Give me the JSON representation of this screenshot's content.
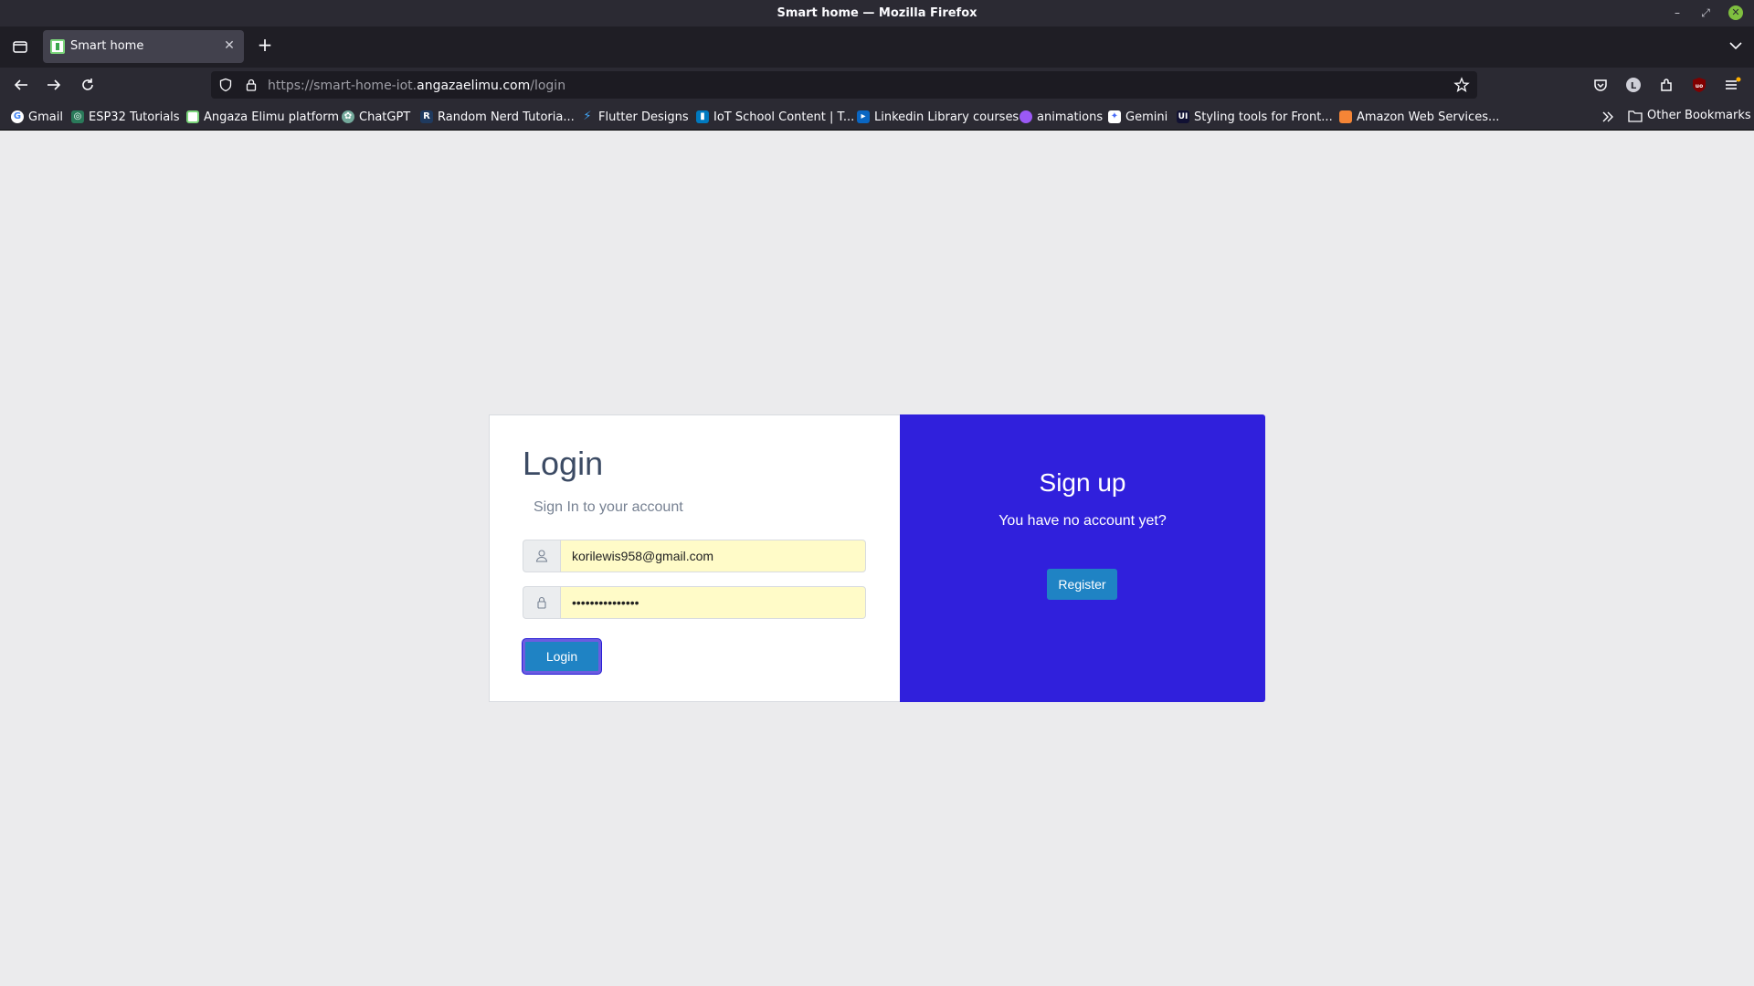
{
  "window": {
    "title": "Smart home — Mozilla Firefox"
  },
  "tabs": [
    {
      "label": "Smart home",
      "active": true
    }
  ],
  "urlbar": {
    "prefix": "https://smart-home-iot.",
    "host": "angazaelimu.com",
    "path": "/login"
  },
  "bookmarks": {
    "items": [
      {
        "label": "Gmail",
        "icon": "google-icon",
        "color": "#4285f4"
      },
      {
        "label": "ESP32 Tutorials",
        "icon": "esp32-icon",
        "color": "#2a7a5a"
      },
      {
        "label": "Angaza Elimu platform",
        "icon": "angaza-icon",
        "color": "#7bd67b"
      },
      {
        "label": "ChatGPT",
        "icon": "chatgpt-icon",
        "color": "#74aa9c"
      },
      {
        "label": "Random Nerd Tutoria...",
        "icon": "rnt-icon",
        "color": "#1f3a5f"
      },
      {
        "label": "Flutter Designs",
        "icon": "flutter-icon",
        "color": "#42a5f5"
      },
      {
        "label": "IoT School Content | T...",
        "icon": "trello-icon",
        "color": "#0079bf"
      },
      {
        "label": "Linkedin Library courses",
        "icon": "linkedin-learning-icon",
        "color": "#0a66c2"
      },
      {
        "label": "animations",
        "icon": "animations-icon",
        "color": "#9b59f5"
      },
      {
        "label": "Gemini",
        "icon": "gemini-icon",
        "color": "#4a6cf7"
      },
      {
        "label": "Styling tools for Front...",
        "icon": "uiverse-icon",
        "color": "#111133"
      },
      {
        "label": "Amazon Web Services...",
        "icon": "aws-icon",
        "color": "#f58536"
      }
    ],
    "other": "Other Bookmarks"
  },
  "login": {
    "title": "Login",
    "subtitle": "Sign In to your account",
    "email_value": "korilewis958@gmail.com",
    "password_value": "•••••••••••••••",
    "button": "Login"
  },
  "signup": {
    "title": "Sign up",
    "text": "You have no account yet?",
    "button": "Register"
  },
  "colors": {
    "signup_bg": "#3020dc",
    "button_bg": "#1f83c4",
    "autofill_bg": "#fffbc8"
  }
}
